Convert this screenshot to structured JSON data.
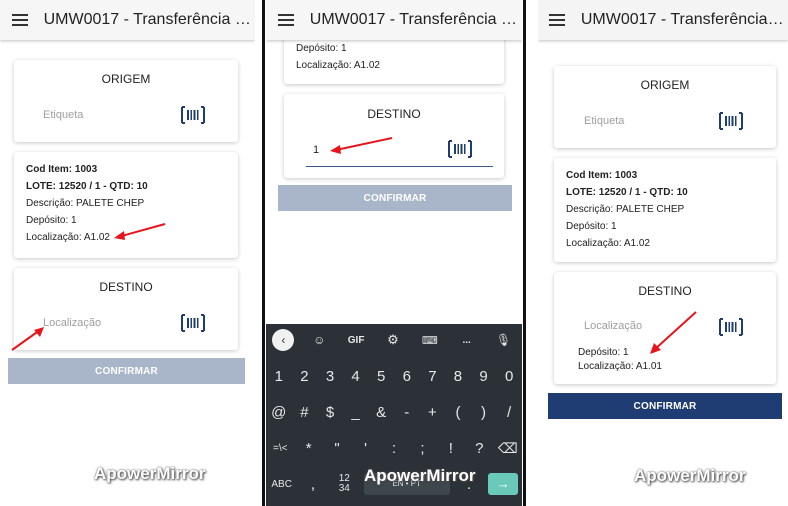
{
  "app_title": "UMW0017 - Transferência d...",
  "watermark": "ApowerMirror",
  "panel1": {
    "origem_title": "ORIGEM",
    "etiqueta_placeholder": "Etiqueta",
    "info": {
      "cod_item": "Cod Item: 1003",
      "lote": "LOTE: 12520 / 1 - QTD: 10",
      "descricao": "Descrição: PALETE CHEP",
      "deposito": "Depósito: 1",
      "localizacao": "Localização: A1.02"
    },
    "destino_title": "DESTINO",
    "localizacao_placeholder": "Localização",
    "confirm_label": "CONFIRMAR"
  },
  "panel2": {
    "deposito_partial": "Depósito: 1",
    "localizacao": "Localização: A1.02",
    "destino_title": "DESTINO",
    "destino_value": "1",
    "confirm_label": "CONFIRMAR",
    "keyboard": {
      "toolbar": [
        "GIF",
        "..."
      ],
      "row_numbers": [
        "1",
        "2",
        "3",
        "4",
        "5",
        "6",
        "7",
        "8",
        "9",
        "0"
      ],
      "row_symbols1": [
        "@",
        "#",
        "$",
        "_",
        "&",
        "-",
        "+",
        "(",
        ")",
        "/"
      ],
      "row_symbols2": [
        "=\\<",
        "*",
        "\"",
        "'",
        ":",
        ";",
        "!",
        "?"
      ],
      "row_bottom": {
        "abc": "ABC",
        "comma": ",",
        "fraction": "12\n34",
        "space": "EN • PT",
        "period": "."
      }
    }
  },
  "panel3": {
    "origem_title": "ORIGEM",
    "etiqueta_placeholder": "Etiqueta",
    "info": {
      "cod_item": "Cod Item: 1003",
      "lote": "LOTE: 12520 / 1 - QTD: 10",
      "descricao": "Descrição: PALETE CHEP",
      "deposito": "Depósito: 1",
      "localizacao": "Localização: A1.02"
    },
    "destino_title": "DESTINO",
    "localizacao_placeholder": "Localização",
    "destino_deposito": "Depósito: 1",
    "destino_localizacao": "Localização: A1.01",
    "confirm_label": "CONFIRMAR"
  },
  "colors": {
    "accent": "#1f3c73",
    "disabled_button": "#a9b6c9",
    "arrow": "#e8141c",
    "barcode": "#1f3c73",
    "keyboard_bg": "#2b3136"
  },
  "icons": [
    "menu-icon",
    "barcode-icon",
    "back-icon",
    "sticker-icon",
    "gear-icon",
    "translate-icon",
    "mic-icon",
    "backspace-icon",
    "enter-icon"
  ]
}
